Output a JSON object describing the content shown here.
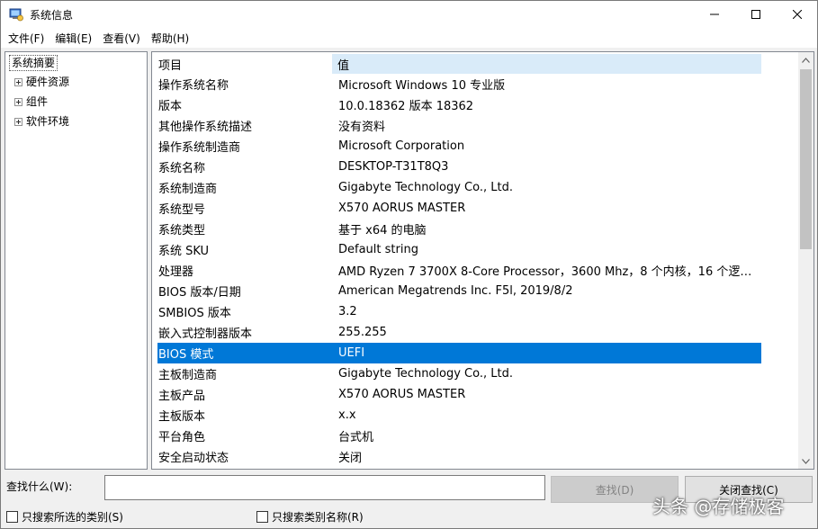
{
  "window": {
    "title": "系统信息"
  },
  "menu": [
    "文件(F)",
    "编辑(E)",
    "查看(V)",
    "帮助(H)"
  ],
  "tree": {
    "root": "系统摘要",
    "nodes": [
      "硬件资源",
      "组件",
      "软件环境"
    ]
  },
  "list": {
    "header": {
      "item": "项目",
      "value": "值"
    },
    "rows": [
      {
        "item": "操作系统名称",
        "value": "Microsoft Windows 10 专业版"
      },
      {
        "item": "版本",
        "value": "10.0.18362 版本 18362"
      },
      {
        "item": "其他操作系统描述",
        "value": "没有资料"
      },
      {
        "item": "操作系统制造商",
        "value": "Microsoft Corporation"
      },
      {
        "item": "系统名称",
        "value": "DESKTOP-T31T8Q3"
      },
      {
        "item": "系统制造商",
        "value": "Gigabyte Technology Co., Ltd."
      },
      {
        "item": "系统型号",
        "value": "X570 AORUS MASTER"
      },
      {
        "item": "系统类型",
        "value": "基于 x64 的电脑"
      },
      {
        "item": "系统 SKU",
        "value": "Default string"
      },
      {
        "item": "处理器",
        "value": "AMD Ryzen 7 3700X 8-Core Processor，3600 Mhz，8 个内核，16 个逻辑..."
      },
      {
        "item": "BIOS 版本/日期",
        "value": "American Megatrends Inc. F5l, 2019/8/2"
      },
      {
        "item": "SMBIOS 版本",
        "value": "3.2"
      },
      {
        "item": "嵌入式控制器版本",
        "value": "255.255"
      },
      {
        "item": "BIOS 模式",
        "value": "UEFI"
      },
      {
        "item": "主板制造商",
        "value": "Gigabyte Technology Co., Ltd."
      },
      {
        "item": "主板产品",
        "value": "X570 AORUS MASTER"
      },
      {
        "item": "主板版本",
        "value": "x.x"
      },
      {
        "item": "平台角色",
        "value": "台式机"
      },
      {
        "item": "安全启动状态",
        "value": "关闭"
      }
    ],
    "selected_index": 13
  },
  "search": {
    "label": "查找什么(W):",
    "value": "",
    "find_button": "查找(D)",
    "close_button": "关闭查找(C)",
    "check_selected_category": "只搜索所选的类别(S)",
    "check_category_names": "只搜索类别名称(R)"
  },
  "watermark": "头条 @存储极客",
  "colors": {
    "selection": "#0078d7",
    "header_value_bg": "#d9ebf9"
  }
}
